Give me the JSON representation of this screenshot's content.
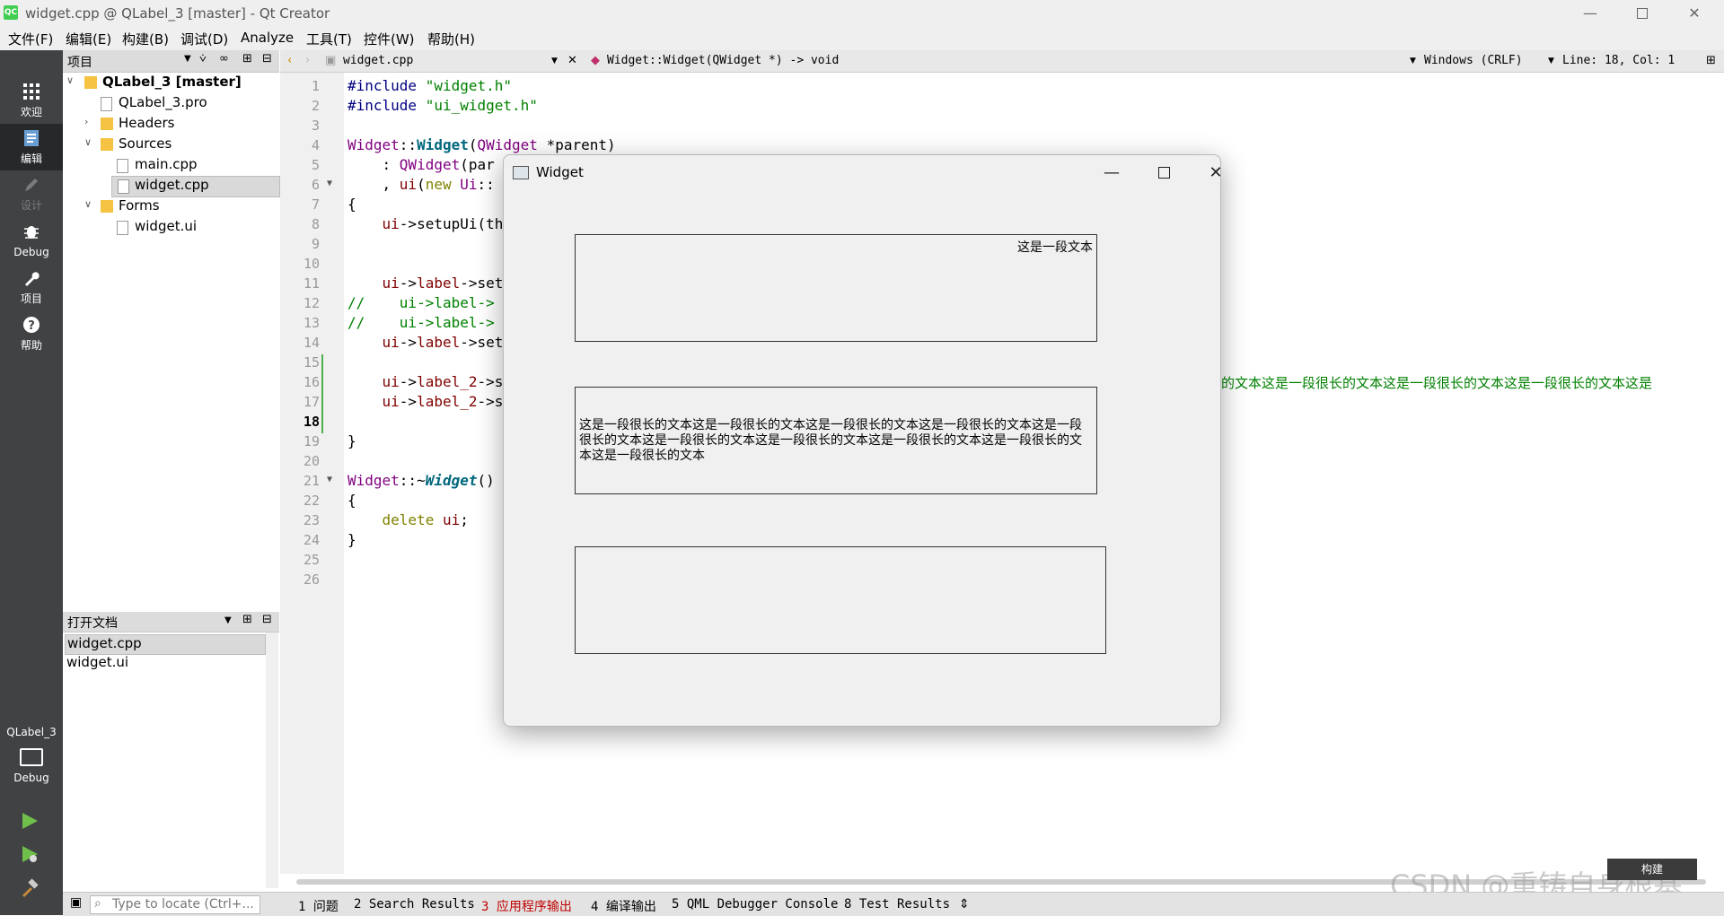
{
  "window": {
    "title": "widget.cpp @ QLabel_3 [master] - Qt Creator",
    "app_icon": "QC"
  },
  "menu": [
    "文件(F)",
    "编辑(E)",
    "构建(B)",
    "调试(D)",
    "Analyze",
    "工具(T)",
    "控件(W)",
    "帮助(H)"
  ],
  "modes": [
    {
      "label": "欢迎",
      "icon": "grid-icon"
    },
    {
      "label": "编辑",
      "icon": "edit-icon"
    },
    {
      "label": "设计",
      "icon": "pencil-icon"
    },
    {
      "label": "Debug",
      "icon": "bug-icon"
    },
    {
      "label": "项目",
      "icon": "wrench-icon"
    },
    {
      "label": "帮助",
      "icon": "help-icon"
    }
  ],
  "kit": {
    "project": "QLabel_3",
    "mode": "Debug"
  },
  "project_pane": {
    "title": "项目",
    "tree": [
      "QLabel_3 [master]",
      "QLabel_3.pro",
      "Headers",
      "Sources",
      "main.cpp",
      "widget.cpp",
      "Forms",
      "widget.ui"
    ]
  },
  "open_docs": {
    "title": "打开文档",
    "items": [
      "widget.cpp",
      "widget.ui"
    ]
  },
  "editor_toolbar": {
    "file": "widget.cpp",
    "symbol": "Widget::Widget(QWidget *) -> void",
    "line_ending": "Windows (CRLF)",
    "position": "Line: 18, Col: 1"
  },
  "line_numbers": [
    "1",
    "2",
    "3",
    "4",
    "5",
    "6",
    "7",
    "8",
    "9",
    "10",
    "11",
    "12",
    "13",
    "14",
    "15",
    "16",
    "17",
    "18",
    "19",
    "20",
    "21",
    "22",
    "23",
    "24",
    "25",
    "26"
  ],
  "code": {
    "l1a": "#include ",
    "l1b": "\"widget.h\"",
    "l2a": "#include ",
    "l2b": "\"ui_widget.h\"",
    "l4a": "Widget",
    "l4b": "::",
    "l4c": "Widget",
    "l4d": "(",
    "l4e": "QWidget",
    "l4f": " *parent)",
    "l5a": "    : ",
    "l5b": "QWidget",
    "l5c": "(par",
    "l6a": "    , ",
    "l6b": "ui",
    "l6c": "(",
    "l6d": "new",
    "l6e": " ",
    "l6f": "Ui",
    "l6g": "::",
    "l7": "{",
    "l8a": "    ",
    "l8b": "ui",
    "l8c": "->setupUi(th",
    "l11a": "    ",
    "l11b": "ui",
    "l11c": "->",
    "l11d": "label",
    "l11e": "->set",
    "l12a": "//    ",
    "l12b": "ui->label->",
    "l13a": "//    ",
    "l13b": "ui->label->",
    "l14a": "    ",
    "l14b": "ui",
    "l14c": "->",
    "l14d": "label",
    "l14e": "->set",
    "l16a": "    ",
    "l16b": "ui",
    "l16c": "->",
    "l16d": "label_2",
    "l16e": "->s",
    "l16tail": "的文本这是一段很长的文本这是一段很长的文本这是一段很长的文本这是",
    "l17a": "    ",
    "l17b": "ui",
    "l17c": "->",
    "l17d": "label_2",
    "l17e": "->s",
    "l19": "}",
    "l21a": "Widget",
    "l21b": "::~",
    "l21c": "Widget",
    "l21d": "()",
    "l22": "{",
    "l23a": "    ",
    "l23b": "delete",
    "l23c": " ",
    "l23d": "ui",
    "l23e": ";",
    "l24": "}"
  },
  "dialog": {
    "title": "Widget",
    "label1": "这是一段文本",
    "label2": "这是一段很长的文本这是一段很长的文本这是一段很长的文本这是一段很长的文本这是一段很长的文本这是一段很长的文本这是一段很长的文本这是一段很长的文本这是一段很长的文本这是一段很长的文本",
    "label3": ""
  },
  "bottom": {
    "locate_placeholder": "Type to locate (Ctrl+...",
    "tabs": [
      "1 问题",
      "2 Search Results",
      "3 应用程序输出",
      "4 编译输出",
      "5 QML Debugger Console",
      "8 Test Results"
    ],
    "build": "构建"
  },
  "watermark": "CSDN @重铸自身根基",
  "colors": {
    "active_tab": "#c00000",
    "qt_green": "#41cd52"
  }
}
